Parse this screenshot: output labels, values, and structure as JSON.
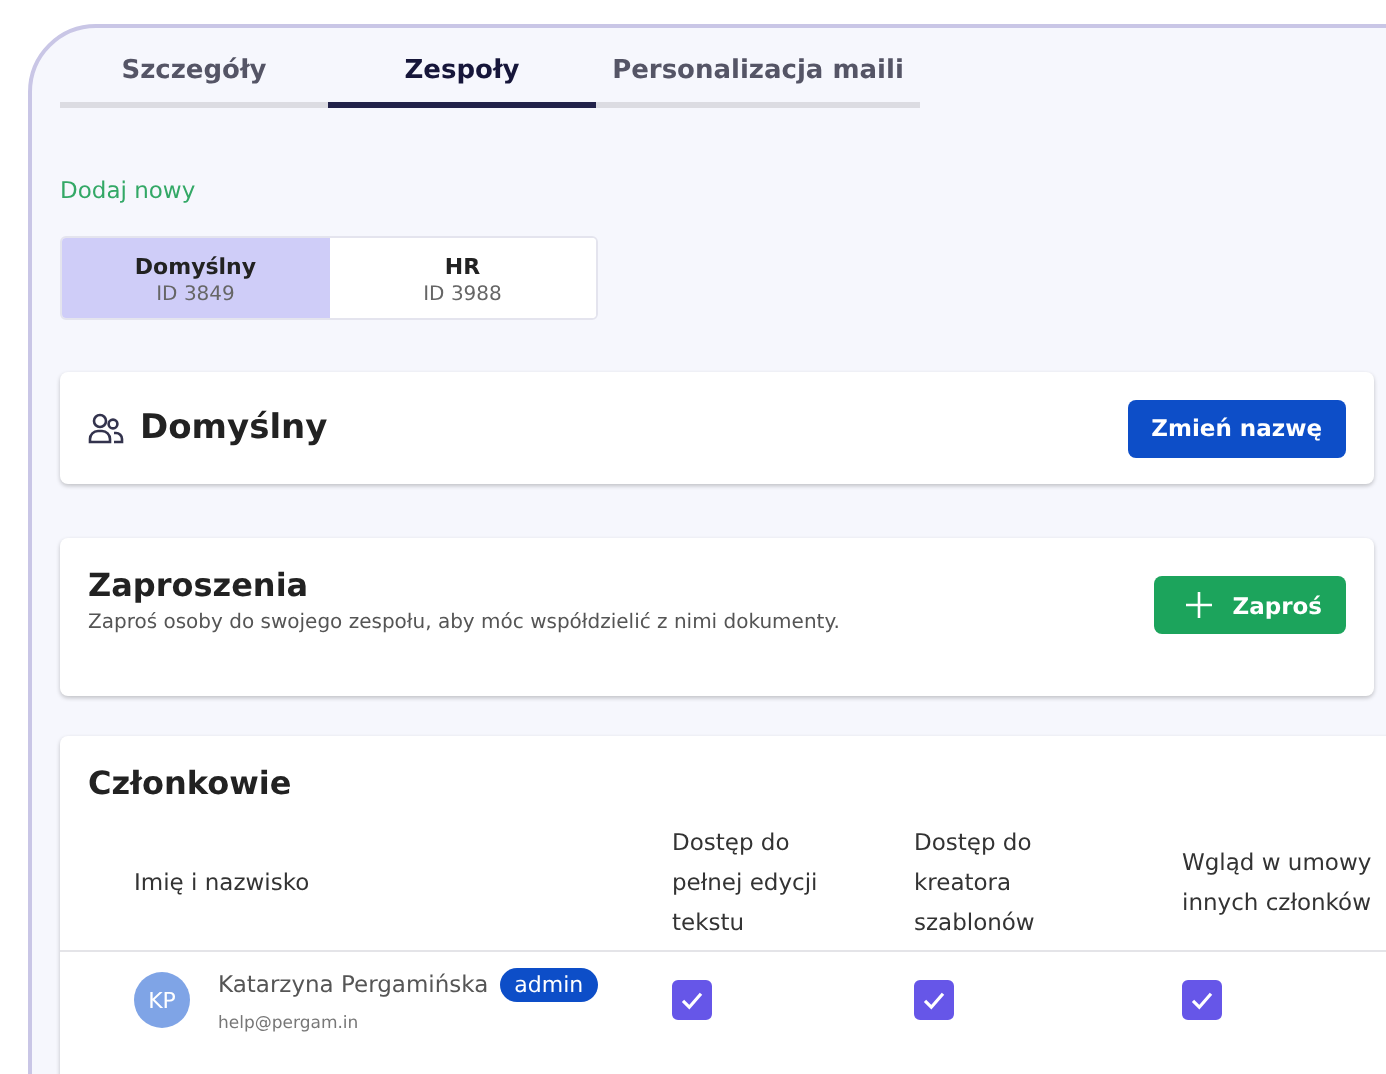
{
  "tabs": [
    {
      "label": "Szczegóły",
      "selected": false
    },
    {
      "label": "Zespoły",
      "selected": true
    },
    {
      "label": "Personalizacja maili",
      "selected": false
    }
  ],
  "add_new_link": "Dodaj nowy",
  "teams": [
    {
      "name": "Domyślny",
      "id": "ID 3849",
      "selected": true
    },
    {
      "name": "HR",
      "id": "ID 3988",
      "selected": false
    }
  ],
  "team_card": {
    "title": "Domyślny",
    "button": "Zmień nazwę"
  },
  "invitations": {
    "title": "Zaproszenia",
    "description": "Zaproś osoby do swojego zespołu, aby móc współdzielić z nimi dokumenty.",
    "button": "Zaproś"
  },
  "members": {
    "title": "Członkowie",
    "columns": [
      "Imię i nazwisko",
      "Dostęp do pełnej edycji tekstu",
      "Dostęp do kreatora szablonów",
      "Wgląd w umowy innych członków"
    ],
    "rows": [
      {
        "initials": "KP",
        "name": "Katarzyna Pergamińska",
        "badge": "admin",
        "email": "help@pergam.in",
        "full_edit": true,
        "template_creator": true,
        "view_contracts": true
      }
    ]
  }
}
